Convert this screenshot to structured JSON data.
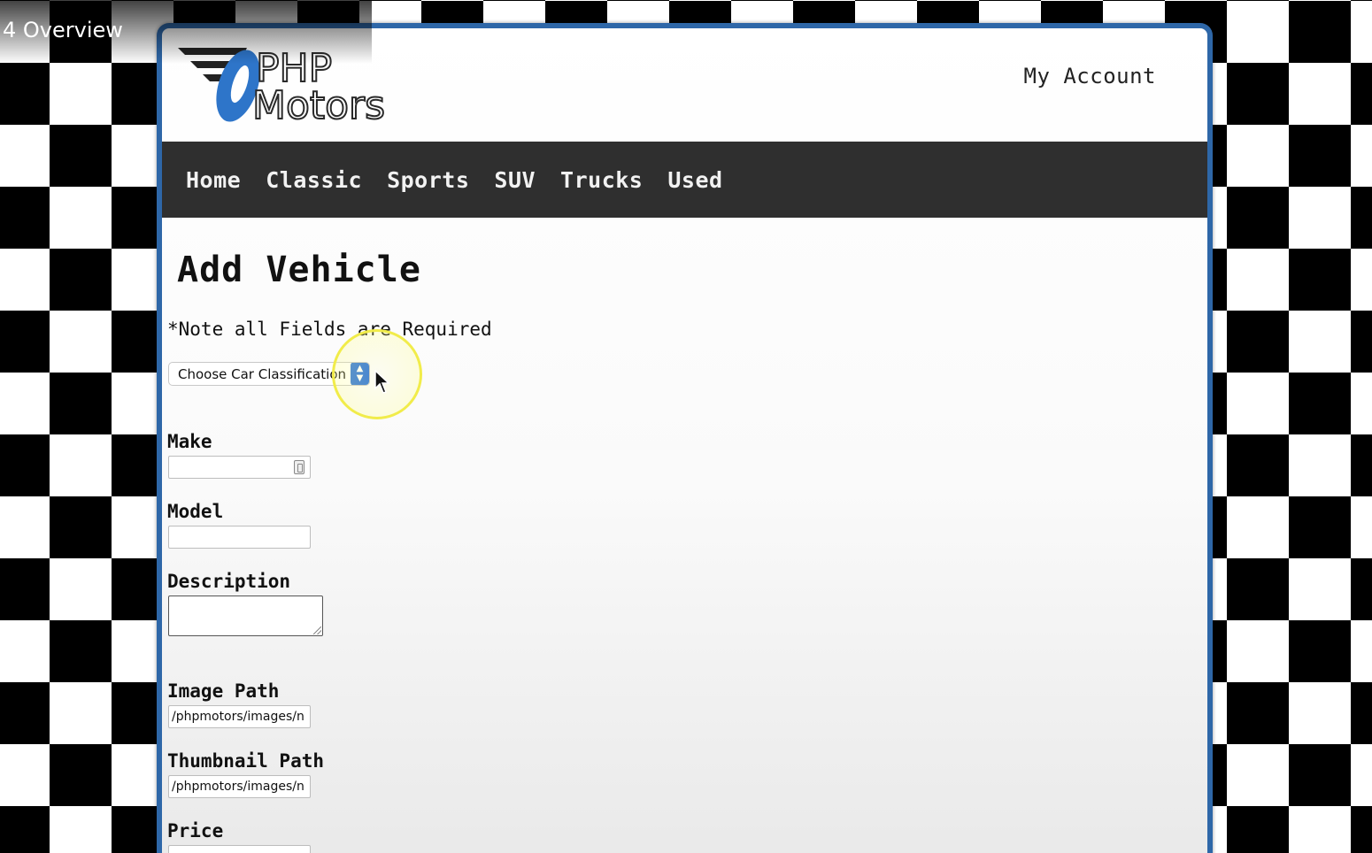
{
  "video": {
    "title": "4 Overview"
  },
  "header": {
    "logo_text_line1": "PHP",
    "logo_text_line2": "Motors",
    "account_link": "My Account"
  },
  "nav": {
    "items": [
      "Home",
      "Classic",
      "Sports",
      "SUV",
      "Trucks",
      "Used"
    ]
  },
  "main": {
    "title": "Add Vehicle",
    "note": "*Note all Fields are Required",
    "classification": {
      "selected": "Choose Car Classification"
    },
    "fields": {
      "make": {
        "label": "Make",
        "value": ""
      },
      "model": {
        "label": "Model",
        "value": ""
      },
      "description": {
        "label": "Description",
        "value": ""
      },
      "image_path": {
        "label": "Image Path",
        "value": "/phpmotors/images/n"
      },
      "thumbnail_path": {
        "label": "Thumbnail Path",
        "value": "/phpmotors/images/n"
      },
      "price": {
        "label": "Price",
        "value": ""
      }
    }
  },
  "colors": {
    "frame_border": "#2e67a8",
    "nav_background": "#2f2f2f",
    "logo_blue": "#2e75c9",
    "cursor_highlight": "#f1ec4a"
  },
  "icons": [
    "logo-speed-stripes-icon",
    "select-arrows-icon",
    "autofill-key-icon",
    "resize-grip-icon",
    "mouse-pointer-icon"
  ]
}
